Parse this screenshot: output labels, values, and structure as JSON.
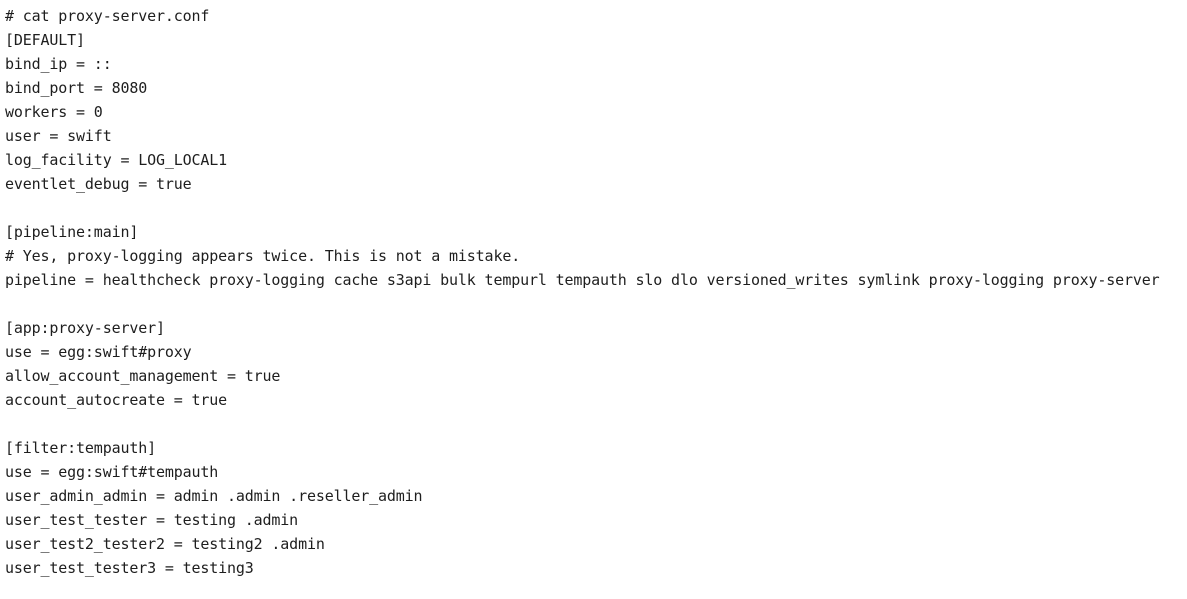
{
  "terminal": {
    "lines": [
      "# cat proxy-server.conf",
      "[DEFAULT]",
      "bind_ip = ::",
      "bind_port = 8080",
      "workers = 0",
      "user = swift",
      "log_facility = LOG_LOCAL1",
      "eventlet_debug = true",
      "",
      "[pipeline:main]",
      "# Yes, proxy-logging appears twice. This is not a mistake.",
      "pipeline = healthcheck proxy-logging cache s3api bulk tempurl tempauth slo dlo versioned_writes symlink proxy-logging proxy-server",
      "",
      "[app:proxy-server]",
      "use = egg:swift#proxy",
      "allow_account_management = true",
      "account_autocreate = true",
      "",
      "[filter:tempauth]",
      "use = egg:swift#tempauth",
      "user_admin_admin = admin .admin .reseller_admin",
      "user_test_tester = testing .admin",
      "user_test2_tester2 = testing2 .admin",
      "user_test_tester3 = testing3"
    ]
  }
}
